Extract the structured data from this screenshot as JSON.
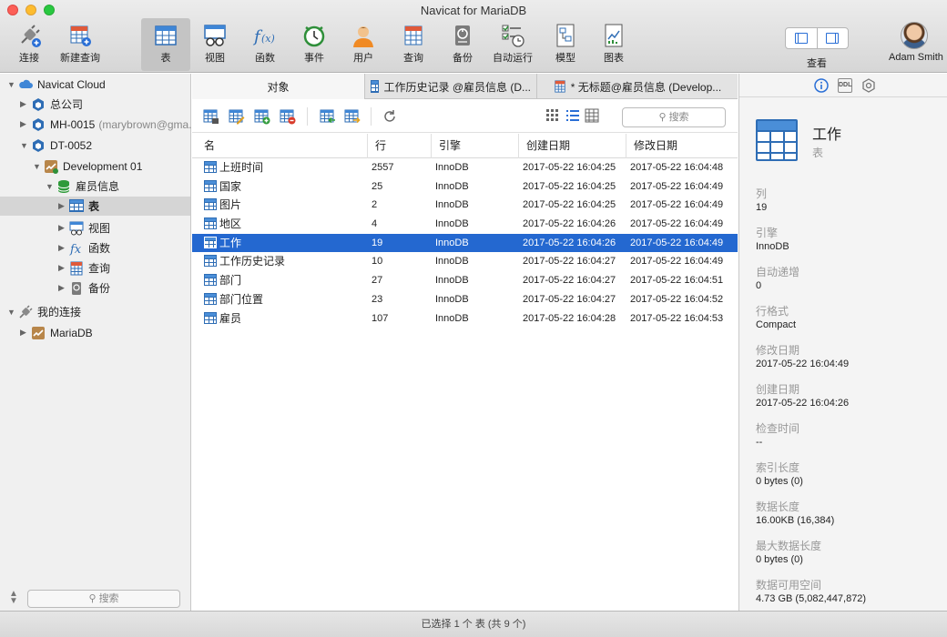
{
  "window": {
    "title": "Navicat for MariaDB"
  },
  "toolbar": {
    "items": [
      {
        "label": "连接",
        "icon": "connection-plug-icon"
      },
      {
        "label": "新建查询",
        "icon": "new-query-icon"
      },
      {
        "label": "表",
        "icon": "table-icon"
      },
      {
        "label": "视图",
        "icon": "view-icon"
      },
      {
        "label": "函数",
        "icon": "function-icon"
      },
      {
        "label": "事件",
        "icon": "event-clock-icon"
      },
      {
        "label": "用户",
        "icon": "user-icon"
      },
      {
        "label": "查询",
        "icon": "query-icon"
      },
      {
        "label": "备份",
        "icon": "backup-icon"
      },
      {
        "label": "自动运行",
        "icon": "automation-icon"
      },
      {
        "label": "模型",
        "icon": "model-icon"
      },
      {
        "label": "图表",
        "icon": "chart-icon"
      }
    ],
    "active": "表",
    "view_label": "查看",
    "user_name": "Adam Smith"
  },
  "sidebar": {
    "nodes": [
      {
        "label": "Navicat Cloud",
        "icon": "cloud-icon",
        "extra": ""
      },
      {
        "label": "总公司",
        "icon": "project-icon",
        "extra": ""
      },
      {
        "label": "MH-0015",
        "icon": "project-icon",
        "extra": "(marybrown@gma..."
      },
      {
        "label": "DT-0052",
        "icon": "project-icon",
        "extra": ""
      },
      {
        "label": "Development 01",
        "icon": "mariadb-connection-icon",
        "extra": ""
      },
      {
        "label": "雇员信息",
        "icon": "database-icon",
        "extra": ""
      },
      {
        "label": "表",
        "icon": "table-icon",
        "extra": ""
      },
      {
        "label": "视图",
        "icon": "view-icon",
        "extra": ""
      },
      {
        "label": "函数",
        "icon": "function-icon",
        "extra": ""
      },
      {
        "label": "查询",
        "icon": "query-icon",
        "extra": ""
      },
      {
        "label": "备份",
        "icon": "backup-icon",
        "extra": ""
      },
      {
        "label": "我的连接",
        "icon": "connection-plug-icon",
        "extra": ""
      },
      {
        "label": "MariaDB",
        "icon": "mariadb-connection-icon",
        "extra": ""
      }
    ],
    "search_placeholder": "搜索"
  },
  "tabs": [
    {
      "label": "对象"
    },
    {
      "label": "工作历史记录 @雇员信息 (D..."
    },
    {
      "label": "* 无标题@雇员信息 (Develop..."
    }
  ],
  "object_toolbar": {
    "search_placeholder": "搜索"
  },
  "table": {
    "headers": [
      "名",
      "行",
      "引擎",
      "创建日期",
      "修改日期"
    ],
    "rows": [
      [
        "上班时间",
        "2557",
        "InnoDB",
        "2017-05-22 16:04:25",
        "2017-05-22 16:04:48"
      ],
      [
        "国家",
        "25",
        "InnoDB",
        "2017-05-22 16:04:25",
        "2017-05-22 16:04:49"
      ],
      [
        "图片",
        "2",
        "InnoDB",
        "2017-05-22 16:04:25",
        "2017-05-22 16:04:49"
      ],
      [
        "地区",
        "4",
        "InnoDB",
        "2017-05-22 16:04:26",
        "2017-05-22 16:04:49"
      ],
      [
        "工作",
        "19",
        "InnoDB",
        "2017-05-22 16:04:26",
        "2017-05-22 16:04:49"
      ],
      [
        "工作历史记录",
        "10",
        "InnoDB",
        "2017-05-22 16:04:27",
        "2017-05-22 16:04:49"
      ],
      [
        "部门",
        "27",
        "InnoDB",
        "2017-05-22 16:04:27",
        "2017-05-22 16:04:51"
      ],
      [
        "部门位置",
        "23",
        "InnoDB",
        "2017-05-22 16:04:27",
        "2017-05-22 16:04:52"
      ],
      [
        "雇员",
        "107",
        "InnoDB",
        "2017-05-22 16:04:28",
        "2017-05-22 16:04:53"
      ]
    ],
    "selected_index": 4
  },
  "details": {
    "ddl_label": "DDL",
    "name": "工作",
    "type": "表",
    "props": [
      {
        "k": "列",
        "v": "19"
      },
      {
        "k": "引擎",
        "v": "InnoDB"
      },
      {
        "k": "自动递增",
        "v": "0"
      },
      {
        "k": "行格式",
        "v": "Compact"
      },
      {
        "k": "修改日期",
        "v": "2017-05-22 16:04:49"
      },
      {
        "k": "创建日期",
        "v": "2017-05-22 16:04:26"
      },
      {
        "k": "检查时间",
        "v": "--"
      },
      {
        "k": "索引长度",
        "v": "0 bytes (0)"
      },
      {
        "k": "数据长度",
        "v": "16.00KB (16,384)"
      },
      {
        "k": "最大数据长度",
        "v": "0 bytes (0)"
      },
      {
        "k": "数据可用空间",
        "v": "4.73 GB (5,082,447,872)"
      }
    ]
  },
  "status": {
    "text": "已选择 1 个 表 (共 9 个)"
  }
}
